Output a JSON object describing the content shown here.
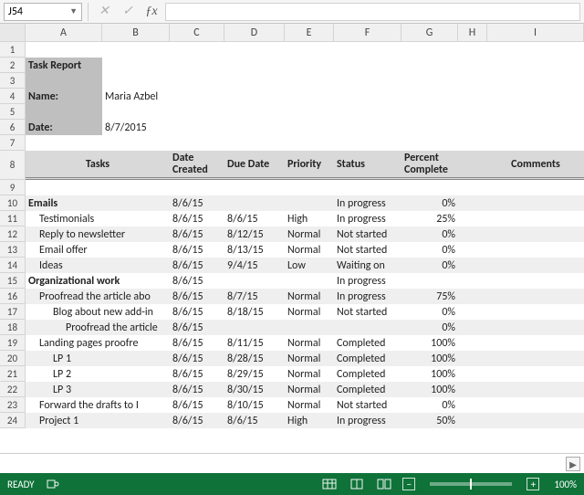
{
  "namebox": {
    "ref": "J54"
  },
  "columns": [
    "A",
    "B",
    "C",
    "D",
    "E",
    "F",
    "G",
    "H",
    "I"
  ],
  "title": "Task Report",
  "labels": {
    "name": "Name:",
    "date": "Date:"
  },
  "meta": {
    "name": "Maria Azbel",
    "date": "8/7/2015"
  },
  "headers": {
    "tasks": "Tasks",
    "dateCreated": "Date Created",
    "dueDate": "Due Date",
    "priority": "Priority",
    "status": "Status",
    "percent": "Percent Complete",
    "comments": "Comments"
  },
  "rows": [
    {
      "r": 10,
      "alt": true,
      "indent": 0,
      "bold": true,
      "task": "Emails",
      "created": "8/6/15",
      "due": "",
      "prio": "",
      "status": "In progress",
      "pct": "0%"
    },
    {
      "r": 11,
      "alt": false,
      "indent": 1,
      "bold": false,
      "task": "Testimonials",
      "created": "8/6/15",
      "due": "8/6/15",
      "prio": "High",
      "status": "In progress",
      "pct": "25%"
    },
    {
      "r": 12,
      "alt": true,
      "indent": 1,
      "bold": false,
      "task": "Reply to newsletter",
      "created": "8/6/15",
      "due": "8/12/15",
      "prio": "Normal",
      "status": "Not started",
      "pct": "0%"
    },
    {
      "r": 13,
      "alt": false,
      "indent": 1,
      "bold": false,
      "task": "Email offer",
      "created": "8/6/15",
      "due": "8/13/15",
      "prio": "Normal",
      "status": "Not started",
      "pct": "0%"
    },
    {
      "r": 14,
      "alt": true,
      "indent": 1,
      "bold": false,
      "task": "Ideas",
      "created": "8/6/15",
      "due": "9/4/15",
      "prio": "Low",
      "status": "Waiting on",
      "pct": "0%"
    },
    {
      "r": 15,
      "alt": false,
      "indent": 0,
      "bold": true,
      "task": "Organizational work",
      "created": "8/6/15",
      "due": "",
      "prio": "",
      "status": "In progress",
      "pct": ""
    },
    {
      "r": 16,
      "alt": true,
      "indent": 1,
      "bold": false,
      "task": "Proofread the article abo",
      "clip": true,
      "created": "8/6/15",
      "due": "8/7/15",
      "prio": "Normal",
      "status": "In progress",
      "pct": "75%"
    },
    {
      "r": 17,
      "alt": false,
      "indent": 2,
      "bold": false,
      "task": "Blog about new add-in",
      "clip": true,
      "created": "8/6/15",
      "due": "8/18/15",
      "prio": "Normal",
      "status": "Not started",
      "pct": "0%"
    },
    {
      "r": 18,
      "alt": true,
      "indent": 3,
      "bold": false,
      "task": "Proofread the article",
      "clip": true,
      "created": "8/6/15",
      "due": "",
      "prio": "",
      "status": "",
      "pct": "0%"
    },
    {
      "r": 19,
      "alt": false,
      "indent": 1,
      "bold": false,
      "task": "Landing pages proofre",
      "clip": true,
      "created": "8/6/15",
      "due": "8/11/15",
      "prio": "Normal",
      "status": "Completed",
      "pct": "100%"
    },
    {
      "r": 20,
      "alt": true,
      "indent": 2,
      "bold": false,
      "task": "LP 1",
      "created": "8/6/15",
      "due": "8/28/15",
      "prio": "Normal",
      "status": "Completed",
      "pct": "100%"
    },
    {
      "r": 21,
      "alt": false,
      "indent": 2,
      "bold": false,
      "task": "LP 2",
      "created": "8/6/15",
      "due": "8/29/15",
      "prio": "Normal",
      "status": "Completed",
      "pct": "100%"
    },
    {
      "r": 22,
      "alt": true,
      "indent": 2,
      "bold": false,
      "task": "LP 3",
      "created": "8/6/15",
      "due": "8/30/15",
      "prio": "Normal",
      "status": "Completed",
      "pct": "100%"
    },
    {
      "r": 23,
      "alt": false,
      "indent": 1,
      "bold": false,
      "task": "Forward the drafts to I",
      "clip": true,
      "created": "8/6/15",
      "due": "8/10/15",
      "prio": "Normal",
      "status": "Not started",
      "pct": "0%"
    },
    {
      "r": 24,
      "alt": true,
      "indent": 1,
      "bold": false,
      "task": "Project 1",
      "created": "8/6/15",
      "due": "8/6/15",
      "prio": "High",
      "status": "In progress",
      "pct": "50%"
    }
  ],
  "status": {
    "ready": "READY",
    "zoom": "100%"
  }
}
